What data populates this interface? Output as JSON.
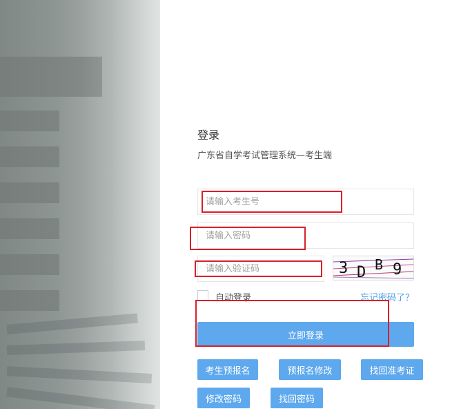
{
  "login": {
    "title": "登录",
    "subtitle": "广东省自学考试管理系统—考生端",
    "exam_number_placeholder": "请输入考生号",
    "password_placeholder": "请输入密码",
    "captcha_placeholder": "请输入验证码",
    "captcha_text": "3DB9",
    "remember_label": "自动登录",
    "forgot_link": "忘记密码了？",
    "submit_label": "立即登录"
  },
  "links": {
    "pre_register": "考生预报名",
    "modify_pre_register": "预报名修改",
    "retrieve_admission_ticket": "找回准考证",
    "change_password": "修改密码",
    "retrieve_password": "找回密码"
  },
  "colors": {
    "accent": "#5ea8ee",
    "annotation_red": "#d8202a",
    "link": "#4a9ee8"
  }
}
